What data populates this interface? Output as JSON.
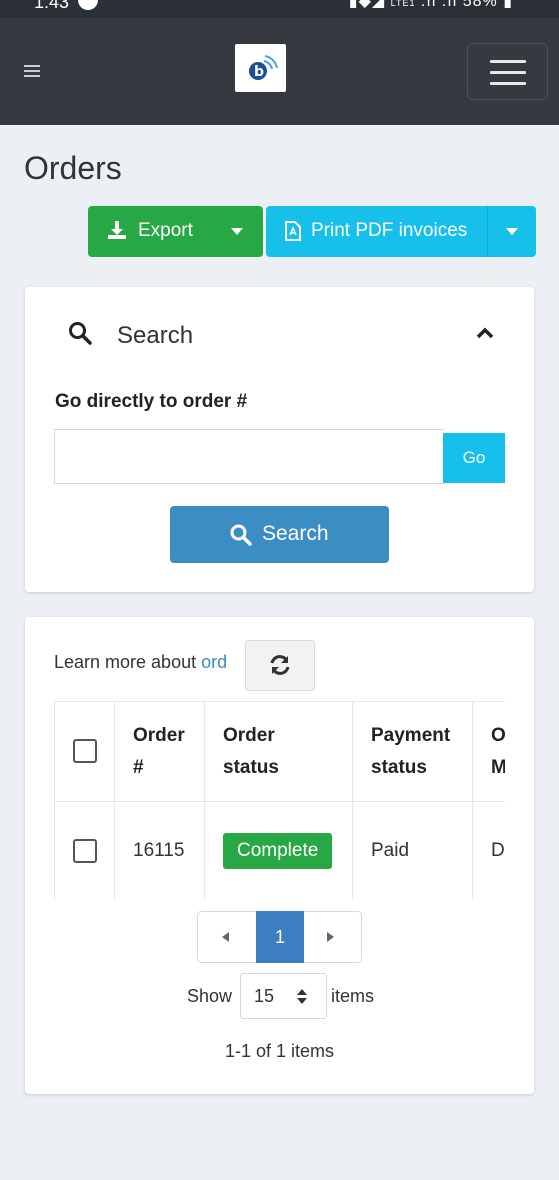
{
  "status_bar": {
    "time": "1:43",
    "network": "LTE1",
    "battery": "58%"
  },
  "header": {
    "menu_icon": "hamburger-icon",
    "logo_icon": "brand-logo-icon",
    "toggler_icon": "navbar-toggler-icon"
  },
  "page": {
    "title": "Orders"
  },
  "toolbar": {
    "export_label": "Export",
    "export_icon": "download-icon",
    "print_label": "Print PDF invoices",
    "print_icon": "pdf-file-icon"
  },
  "search": {
    "title": "Search",
    "goto_label": "Go directly to order #",
    "goto_value": "",
    "goto_button": "Go",
    "search_button": "Search"
  },
  "orders": {
    "learn_prefix": "Learn more about ",
    "learn_link": "ord",
    "columns": [
      {
        "line1": "Order",
        "line2": "#"
      },
      {
        "line1": "Order",
        "line2": "status"
      },
      {
        "line1": "Payment",
        "line2": "status"
      },
      {
        "line1": "O",
        "line2": "M"
      }
    ],
    "rows": [
      {
        "order_number": "16115",
        "order_status": "Complete",
        "payment_status": "Paid",
        "more": "Di"
      }
    ],
    "pagination": {
      "current": "1"
    },
    "page_size": {
      "label_before": "Show",
      "value": "15",
      "label_after": "items"
    },
    "summary": "1-1 of 1 items",
    "colors": {
      "complete_badge": "#28a745",
      "primary": "#3c7fc0",
      "info": "#17c0ea",
      "success": "#28a745"
    }
  }
}
